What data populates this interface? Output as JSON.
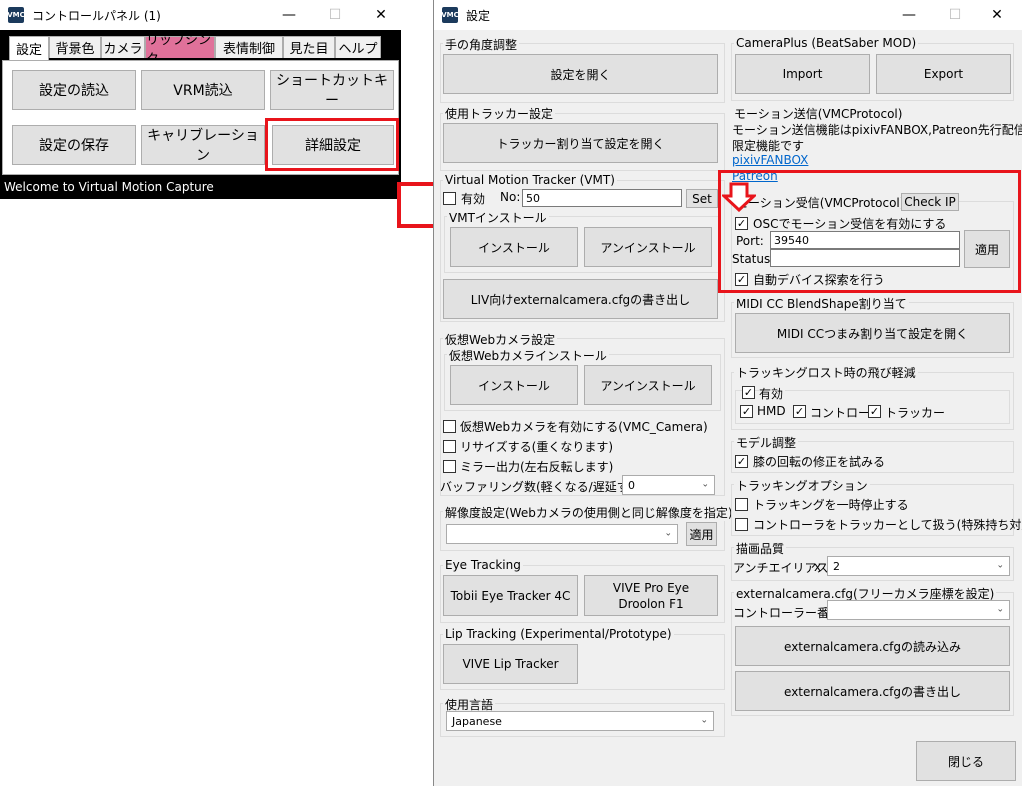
{
  "control_panel": {
    "title": "コントロールパネル (1)",
    "tabs": [
      "設定",
      "背景色",
      "カメラ",
      "リップシンク",
      "表情制御",
      "見た目",
      "ヘルプ"
    ],
    "buttons": {
      "load_settings": "設定の読込",
      "load_vrm": "VRM読込",
      "shortcut": "ショートカットキー",
      "save_settings": "設定の保存",
      "calibration": "キャリブレーション",
      "advanced": "詳細設定"
    },
    "status": "Welcome to Virtual Motion Capture"
  },
  "settings": {
    "title": "設定",
    "hand_angle": {
      "label": "手の角度調整",
      "button": "設定を開く"
    },
    "trackers": {
      "label": "使用トラッカー設定",
      "button": "トラッカー割り当て設定を開く"
    },
    "vmt": {
      "label": "Virtual Motion Tracker (VMT)",
      "enable_label": "有効",
      "no_label": "No:",
      "no_value": "50",
      "set_button": "Set",
      "install_group": "VMTインストール",
      "install": "インストール",
      "uninstall": "アンインストール",
      "liv_button": "LIV向けexternalcamera.cfgの書き出し"
    },
    "webcam": {
      "label": "仮想Webカメラ設定",
      "install_group": "仮想Webカメラインストール",
      "install": "インストール",
      "uninstall": "アンインストール",
      "enable": "仮想Webカメラを有効にする(VMC_Camera)",
      "resize": "リサイズする(重くなります)",
      "mirror": "ミラー出力(左右反転します)",
      "buffering_label": "バッファリング数(軽くなる/遅延する)：",
      "buffering_value": "0"
    },
    "resolution": {
      "label": "解像度設定(Webカメラの使用側と同じ解像度を指定)",
      "value": "",
      "apply": "適用"
    },
    "eye_tracking": {
      "label": "Eye Tracking",
      "tobii": "Tobii Eye Tracker 4C",
      "vive_line1": "VIVE Pro Eye",
      "vive_line2": "Droolon F1"
    },
    "lip_tracking": {
      "label": "Lip Tracking (Experimental/Prototype)",
      "button": "VIVE Lip Tracker"
    },
    "language": {
      "label": "使用言語",
      "value": "Japanese"
    },
    "cameraplus": {
      "label": "CameraPlus (BeatSaber MOD)",
      "import": "Import",
      "export": "Export"
    },
    "motion_send": {
      "label": "モーション送信(VMCProtocol)",
      "line1": "モーション送信機能はpixivFANBOX,Patreon先行配信版",
      "line2": "限定機能です",
      "link1": "pixivFANBOX",
      "link2": "Patreon"
    },
    "motion_recv": {
      "label": "モーション受信(VMCProtocol) IP:",
      "check_ip": "Check IP",
      "enable_osc": "OSCでモーション受信を有効にする",
      "port_label": "Port:",
      "port_value": "39540",
      "status_label": "Status:",
      "status_value": "",
      "apply": "適用",
      "auto_discover": "自動デバイス探索を行う"
    },
    "midi": {
      "label": "MIDI CC BlendShape割り当て",
      "button": "MIDI CCつまみ割り当て設定を開く"
    },
    "tracking_lost": {
      "label": "トラッキングロスト時の飛び軽減",
      "enable": "有効",
      "hmd": "HMD",
      "controller": "コントローラ",
      "tracker": "トラッカー"
    },
    "model_adjust": {
      "label": "モデル調整",
      "knee": "膝の回転の修正を試みる"
    },
    "tracking_options": {
      "label": "トラッキングオプション",
      "pause": "トラッキングを一時停止する",
      "controller_as_tracker": "コントローラをトラッカーとして扱う(特殊持ち対応)"
    },
    "quality": {
      "label": "描画品質",
      "aa_label": "アンチエイリアス",
      "aa_x": "x",
      "aa_value": "2"
    },
    "external_camera": {
      "label": "externalcamera.cfg(フリーカメラ座標を設定)",
      "controller_no_label": "コントローラー番号：",
      "controller_no_value": "",
      "load": "externalcamera.cfgの読み込み",
      "save": "externalcamera.cfgの書き出し"
    },
    "close": "閉じる"
  },
  "icons": {
    "app": "vmc-app-icon",
    "arrow_right": "red-right-arrow",
    "arrow_down": "red-down-arrow"
  },
  "colors": {
    "highlight_red": "#e8141b",
    "lipsync_tab": "#e0719a",
    "link_blue": "#0066cc"
  }
}
